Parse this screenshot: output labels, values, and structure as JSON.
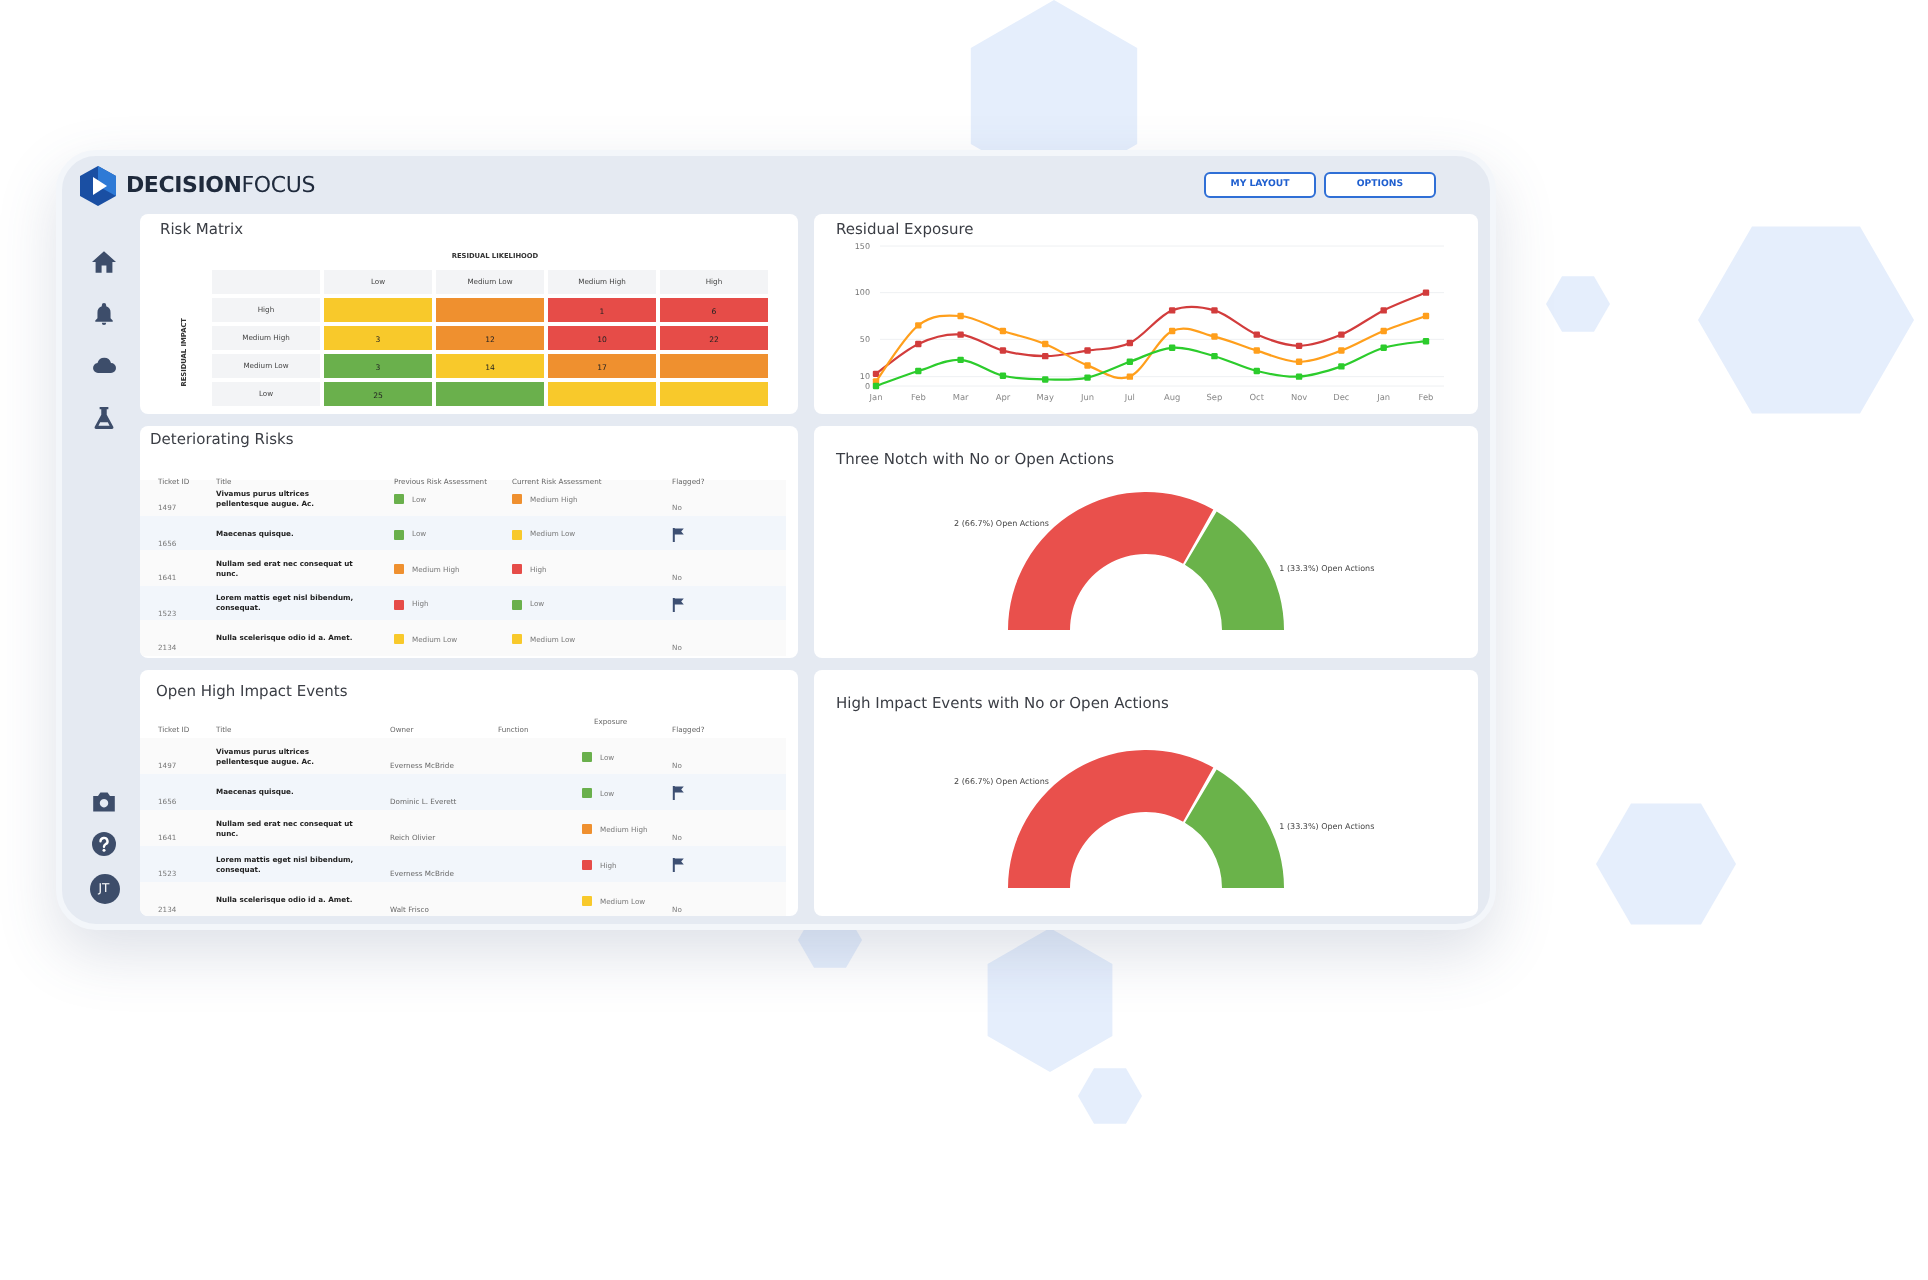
{
  "header": {
    "logo": "**DECISION**FOCUS",
    "buttons": [
      "MY LAYOUT",
      "OPTIONS"
    ]
  },
  "sidebar": {
    "avatar": "JT"
  },
  "risk_matrix": {
    "title": "Risk Matrix",
    "x_label": "RESIDUAL LIKELIHOOD",
    "y_label": "RESIDUAL IMPACT",
    "columns": [
      "Low",
      "Medium Low",
      "Medium High",
      "High"
    ],
    "rows": [
      {
        "label": "High",
        "cells": [
          {
            "color": "#f8c92b"
          },
          {
            "color": "#ef902f"
          },
          {
            "text": "1",
            "color": "#e64c48"
          },
          {
            "text": "6",
            "color": "#e64c48"
          }
        ]
      },
      {
        "label": "Medium High",
        "cells": [
          {
            "text": "3",
            "color": "#f8c92b"
          },
          {
            "text": "12",
            "color": "#ef902f"
          },
          {
            "text": "10",
            "color": "#e64c48"
          },
          {
            "text": "22",
            "color": "#e64c48"
          }
        ]
      },
      {
        "label": "Medium Low",
        "cells": [
          {
            "text": "3",
            "color": "#6ab04c"
          },
          {
            "text": "14",
            "color": "#f8c92b"
          },
          {
            "text": "17",
            "color": "#ef902f"
          },
          {
            "color": "#ef902f"
          }
        ]
      },
      {
        "label": "Low",
        "cells": [
          {
            "text": "25",
            "color": "#6ab04c"
          },
          {
            "color": "#6ab04c"
          },
          {
            "color": "#f8c92b"
          },
          {
            "color": "#f8c92b"
          }
        ]
      }
    ]
  },
  "residual_exposure": {
    "title": "Residual Exposure",
    "chart_data": {
      "type": "line",
      "categories": [
        "Jan",
        "Feb",
        "Mar",
        "Apr",
        "May",
        "Jun",
        "Jul",
        "Aug",
        "Sep",
        "Oct",
        "Nov",
        "Dec",
        "Jan",
        "Feb"
      ],
      "ylim": [
        0,
        150
      ],
      "yticks": [
        0,
        10,
        50,
        100,
        150
      ],
      "grid": true,
      "series": [
        {
          "color": "#d23c3c",
          "marker": "square",
          "values": [
            13,
            45,
            55,
            38,
            32,
            38,
            46,
            81,
            81,
            55,
            43,
            55,
            81,
            100
          ]
        },
        {
          "color": "#ff9f1c",
          "marker": "square",
          "values": [
            5,
            65,
            75,
            59,
            45,
            22,
            10,
            59,
            53,
            38,
            26,
            38,
            59,
            75
          ]
        },
        {
          "color": "#2ccc2c",
          "marker": "square",
          "values": [
            0,
            16,
            28,
            11,
            7,
            9,
            26,
            41,
            32,
            16,
            10,
            21,
            41,
            48
          ]
        }
      ]
    }
  },
  "deteriorating_risks": {
    "title": "Deteriorating Risks",
    "columns": [
      "Ticket ID",
      "Title",
      "Previous Risk Assessment",
      "Current Risk Assessment",
      "Flagged?"
    ],
    "rows": [
      {
        "ticket_id": "1497",
        "title": "Vivamus purus ultrices pellentesque augue. Ac.",
        "previous": {
          "label": "Low",
          "color": "#6ab04c"
        },
        "current": {
          "label": "Medium High",
          "color": "#ef902f"
        },
        "flagged": false,
        "flagged_text": "No"
      },
      {
        "ticket_id": "1656",
        "title": "Maecenas quisque.",
        "previous": {
          "label": "Low",
          "color": "#6ab04c"
        },
        "current": {
          "label": "Medium Low",
          "color": "#f8c92b"
        },
        "flagged": true
      },
      {
        "ticket_id": "1641",
        "title": "Nullam sed erat nec consequat ut nunc.",
        "previous": {
          "label": "Medium High",
          "color": "#ef902f"
        },
        "current": {
          "label": "High",
          "color": "#e64c48"
        },
        "flagged": false,
        "flagged_text": "No"
      },
      {
        "ticket_id": "1523",
        "title": "Lorem mattis eget nisl bibendum, consequat.",
        "previous": {
          "label": "High",
          "color": "#e64c48"
        },
        "current": {
          "label": "Low",
          "color": "#6ab04c"
        },
        "flagged": true
      },
      {
        "ticket_id": "2134",
        "title": "Nulla scelerisque odio id a. Amet.",
        "previous": {
          "label": "Medium Low",
          "color": "#f8c92b"
        },
        "current": {
          "label": "Medium Low",
          "color": "#f8c92b"
        },
        "flagged": false,
        "flagged_text": "No"
      }
    ]
  },
  "three_notch": {
    "title": "Three Notch with No or Open Actions",
    "chart_data": {
      "type": "donut",
      "values": [
        2,
        1
      ],
      "colors": [
        "#e9504c",
        "#6ab34a"
      ],
      "value_labels": [
        "2 (66.7%) Open Actions",
        "1 (33.3%) Open Actions"
      ]
    }
  },
  "open_high_impact_events": {
    "title": "Open High Impact Events",
    "columns": [
      "Ticket ID",
      "Title",
      "Owner",
      "Function",
      "Exposure",
      "Flagged?"
    ],
    "rows": [
      {
        "ticket_id": "1497",
        "title": "Vivamus purus ultrices pellentesque augue. Ac.",
        "owner": "Everness McBride",
        "exposure": {
          "label": "Low",
          "color": "#6ab04c"
        },
        "flagged": false,
        "flagged_text": "No"
      },
      {
        "ticket_id": "1656",
        "title": "Maecenas quisque.",
        "owner": "Dominic L. Everett",
        "exposure": {
          "label": "Low",
          "color": "#6ab04c"
        },
        "flagged": true
      },
      {
        "ticket_id": "1641",
        "title": "Nullam sed erat nec consequat ut nunc.",
        "owner": "Reich Olivier",
        "exposure": {
          "label": "Medium High",
          "color": "#ef902f"
        },
        "flagged": false,
        "flagged_text": "No"
      },
      {
        "ticket_id": "1523",
        "title": "Lorem mattis eget nisl bibendum, consequat.",
        "owner": "Everness McBride",
        "exposure": {
          "label": "High",
          "color": "#e64c48"
        },
        "flagged": true
      },
      {
        "ticket_id": "2134",
        "title": "Nulla scelerisque odio id a. Amet.",
        "owner": "Walt Frisco",
        "exposure": {
          "label": "Medium Low",
          "color": "#f8c92b"
        },
        "flagged": false,
        "flagged_text": "No"
      }
    ]
  },
  "high_impact_events": {
    "title": "High Impact Events with No or Open Actions",
    "chart_data": {
      "type": "donut",
      "values": [
        2,
        1
      ],
      "colors": [
        "#e9504c",
        "#6ab34a"
      ],
      "value_labels": [
        "2 (66.7%) Open Actions",
        "1 (33.3%) Open Actions"
      ]
    }
  }
}
